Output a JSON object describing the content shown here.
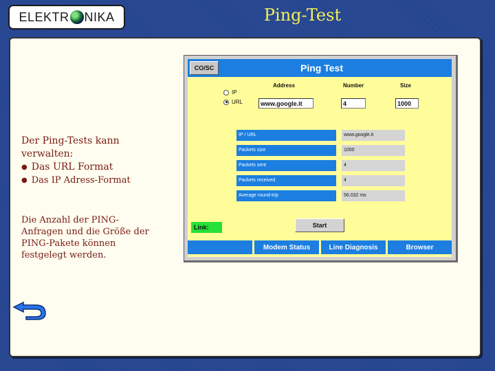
{
  "slide": {
    "logo": {
      "left": "ELEKTR",
      "right": "NIKA"
    },
    "title": "Ping-Test",
    "description": {
      "heading": "Der Ping-Tests kann verwalten:",
      "bullets": [
        "Das URL Format",
        "Das IP Adress-Format"
      ],
      "paragraph": "Die Anzahl der PING-Anfragen und die Größe der PING-Pakete können festgelegt werden."
    },
    "colors": {
      "background": "#23438f",
      "title": "#f3f05a",
      "text": "#7a1a10",
      "app_bg": "#fffc9a",
      "accent_blue": "#1b7ee0",
      "link_green": "#27e038"
    }
  },
  "app": {
    "cosc_label": "CO/SC",
    "title": "Ping Test",
    "radio_ip": "IP",
    "radio_url": "URL",
    "selected": "URL",
    "col_address": "Address",
    "col_number": "Number",
    "col_size": "Size",
    "address_value": "www.google.it",
    "number_value": "4",
    "size_value": "1000",
    "results": [
      {
        "label": "IP / URL",
        "value": "www.google.it"
      },
      {
        "label": "Packets size",
        "value": "1000"
      },
      {
        "label": "Packets sent",
        "value": "4"
      },
      {
        "label": "Packets received",
        "value": "4"
      },
      {
        "label": "Average round-trip",
        "value": "56.032 ms"
      }
    ],
    "link_label": "Link:",
    "start_label": "Start",
    "nav": [
      "Modem Status",
      "Line Diagnosis",
      "Browser"
    ]
  },
  "icons": {
    "back": "back-arrow-icon",
    "globe": "globe-icon"
  }
}
